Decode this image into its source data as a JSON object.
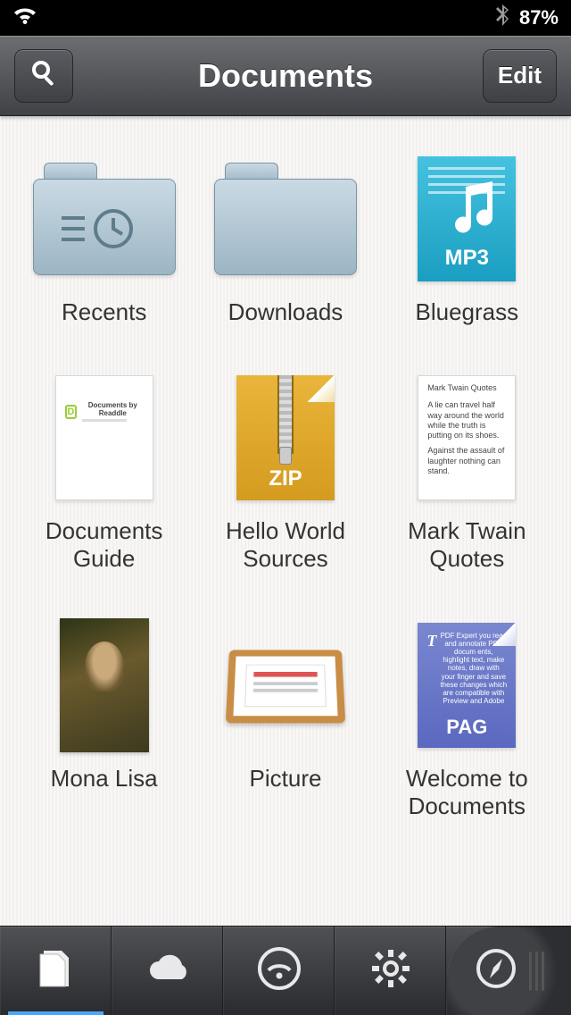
{
  "status": {
    "battery_pct": "87%"
  },
  "nav": {
    "title": "Documents",
    "edit_label": "Edit"
  },
  "items": [
    {
      "label": "Recents",
      "kind": "folder-recents"
    },
    {
      "label": "Downloads",
      "kind": "folder"
    },
    {
      "label": "Bluegrass",
      "kind": "mp3",
      "badge": "MP3"
    },
    {
      "label": "Documents Guide",
      "kind": "doc",
      "preview_title": "Documents by Readdle"
    },
    {
      "label": "Hello World Sources",
      "kind": "zip",
      "badge": "ZIP"
    },
    {
      "label": "Mark Twain Quotes",
      "kind": "text",
      "preview_title": "Mark Twain Quotes",
      "preview_body1": "A lie can travel half way around the world while the truth is putting on its shoes.",
      "preview_body2": "Against the assault of laughter nothing can stand."
    },
    {
      "label": "Mona Lisa",
      "kind": "image-mona"
    },
    {
      "label": "Picture",
      "kind": "tray"
    },
    {
      "label": "Welcome to Documents",
      "kind": "pag",
      "badge": "PAG",
      "preview_body1": "PDF Expert you read and annotate PDF docum ents, highlight text, make notes, draw with your finger and save these changes which are compatible with Preview and Adobe"
    }
  ],
  "tabs": {
    "documents": "documents",
    "cloud": "cloud",
    "network": "network",
    "settings": "settings",
    "browser": "browser"
  }
}
